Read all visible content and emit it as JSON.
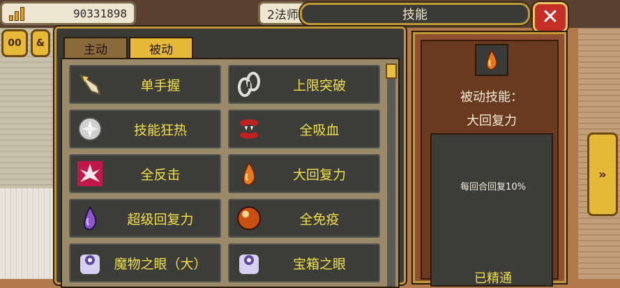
{
  "hud": {
    "gold": "90331898",
    "class_label": "2法师"
  },
  "window": {
    "title": "技能",
    "close_glyph": "✕"
  },
  "side_buttons": [
    "00",
    "&"
  ],
  "tabs": [
    {
      "label": "主动",
      "active": false
    },
    {
      "label": "被动",
      "active": true
    }
  ],
  "skills": [
    {
      "name": "单手握",
      "icon": "sword-grip-icon"
    },
    {
      "name": "上限突破",
      "icon": "broken-chain-icon"
    },
    {
      "name": "技能狂热",
      "icon": "fervor-orb-icon"
    },
    {
      "name": "全吸血",
      "icon": "vampire-fang-icon"
    },
    {
      "name": "全反击",
      "icon": "counter-burst-icon"
    },
    {
      "name": "大回复力",
      "icon": "orange-drop-icon"
    },
    {
      "name": "超级回复力",
      "icon": "purple-drop-icon"
    },
    {
      "name": "全免疫",
      "icon": "immunity-orb-icon"
    },
    {
      "name": "魔物之眼（大）",
      "icon": "monster-eye-icon"
    },
    {
      "name": "宝箱之眼",
      "icon": "chest-eye-icon"
    }
  ],
  "detail": {
    "type_label": "被动技能：",
    "skill_name": "大回复力",
    "description": "每回合回复10%",
    "status": "已精通",
    "icon": "orange-drop-icon"
  },
  "next_glyph": "»",
  "colors": {
    "accent_gold": "#e8b838",
    "skill_text": "#f0e04a",
    "close_red": "#c43028"
  }
}
